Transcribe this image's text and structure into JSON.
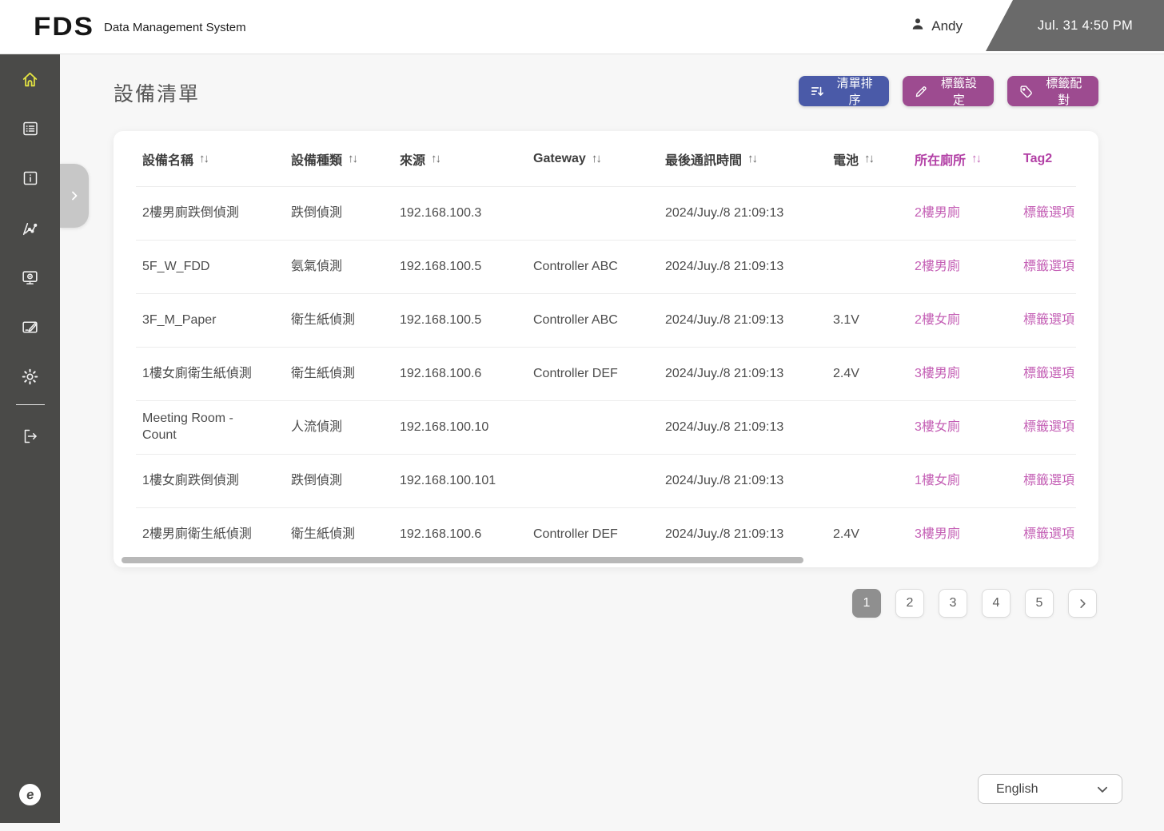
{
  "header": {
    "logo": "FDS",
    "app_title": "Data Management System",
    "user_name": "Andy",
    "datetime": "Jul. 31  4:50 PM"
  },
  "sidebar": {
    "items": [
      {
        "name": "home",
        "icon": "home-icon",
        "active": true
      },
      {
        "name": "device-list",
        "icon": "list-icon",
        "active": false
      },
      {
        "name": "info",
        "icon": "info-icon",
        "active": false
      },
      {
        "name": "analytics",
        "icon": "line-chart-icon",
        "active": false
      },
      {
        "name": "monitor",
        "icon": "monitor-icon",
        "active": false
      },
      {
        "name": "edit-board",
        "icon": "edit-icon",
        "active": false
      },
      {
        "name": "settings",
        "icon": "gear-icon",
        "active": false
      },
      {
        "name": "logout",
        "icon": "logout-icon",
        "active": false
      }
    ]
  },
  "page": {
    "title": "設備清單",
    "buttons": {
      "sort": "清單排序",
      "tag_settings": "標籤設定",
      "tag_pairing": "標籤配對"
    }
  },
  "table": {
    "sort_glyph": "↑↓",
    "columns": [
      {
        "key": "name",
        "label": "設備名稱",
        "sortable": true,
        "accent": false
      },
      {
        "key": "type",
        "label": "設備種類",
        "sortable": true,
        "accent": false
      },
      {
        "key": "source",
        "label": "來源",
        "sortable": true,
        "accent": false
      },
      {
        "key": "gateway",
        "label": "Gateway",
        "sortable": true,
        "accent": false
      },
      {
        "key": "last-comm",
        "label": "最後通訊時間",
        "sortable": true,
        "accent": false
      },
      {
        "key": "battery",
        "label": "電池",
        "sortable": true,
        "accent": false
      },
      {
        "key": "toilet",
        "label": "所在廁所",
        "sortable": true,
        "accent": true
      },
      {
        "key": "tag2",
        "label": "Tag2",
        "sortable": false,
        "accent": true
      }
    ],
    "rows": [
      [
        "2樓男廁跌倒偵測",
        "跌倒偵測",
        "192.168.100.3",
        "",
        "2024/Juy./8 21:09:13",
        "",
        "2樓男廁",
        "標籤選項"
      ],
      [
        "5F_W_FDD",
        "氨氣偵測",
        "192.168.100.5",
        "Controller ABC",
        "2024/Juy./8 21:09:13",
        "",
        "2樓男廁",
        "標籤選項"
      ],
      [
        "3F_M_Paper",
        "衛生紙偵測",
        "192.168.100.5",
        "Controller ABC",
        "2024/Juy./8 21:09:13",
        "3.1V",
        "2樓女廁",
        "標籤選項"
      ],
      [
        "1樓女廁衛生紙偵測",
        "衛生紙偵測",
        "192.168.100.6",
        "Controller DEF",
        "2024/Juy./8 21:09:13",
        "2.4V",
        "3樓男廁",
        "標籤選項"
      ],
      [
        "Meeting Room - Count",
        "人流偵測",
        "192.168.100.10",
        "",
        "2024/Juy./8 21:09:13",
        "",
        "3樓女廁",
        "標籤選項"
      ],
      [
        "1樓女廁跌倒偵測",
        "跌倒偵測",
        "192.168.100.101",
        "",
        "2024/Juy./8 21:09:13",
        "",
        "1樓女廁",
        "標籤選項"
      ],
      [
        "2樓男廁衛生紙偵測",
        "衛生紙偵測",
        "192.168.100.6",
        "Controller DEF",
        "2024/Juy./8 21:09:13",
        "2.4V",
        "3樓男廁",
        "標籤選項"
      ]
    ]
  },
  "pagination": {
    "pages": [
      "1",
      "2",
      "3",
      "4",
      "5"
    ],
    "active": "1"
  },
  "language": {
    "selected": "English"
  },
  "colors": {
    "accent_purple_header": "#b23fa5",
    "accent_purple_cell": "#c45fb5",
    "button_blue": "#4a5aa8",
    "button_purple": "#9d4b90",
    "sidebar_bg": "#4a4a48",
    "active_icon_yellow": "#e3e342",
    "datetime_bg": "#6a6a6a"
  }
}
